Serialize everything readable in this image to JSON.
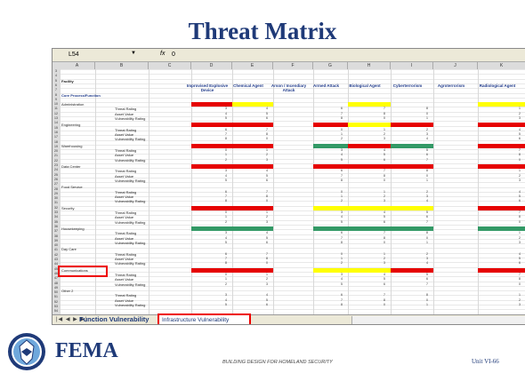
{
  "title": "Threat Matrix",
  "formula_bar": {
    "cell_ref": "L54",
    "fx": "fx",
    "value": "0"
  },
  "column_letters": [
    "A",
    "B",
    "C",
    "D",
    "E",
    "F",
    "G",
    "H",
    "I",
    "J",
    "K"
  ],
  "facility_label": "Facility",
  "function_label": "Core Process/Function",
  "threat_headers": [
    "Improvised Explosive Device",
    "Chemical Agent",
    "Arson / Incendiary Attack",
    "Armed Attack",
    "Biological Agent",
    "Cyberterrorism",
    "Agroterrorism",
    "Radiological Agent"
  ],
  "functions": [
    "Administration",
    "Engineering",
    "Warehousing",
    "Data Center",
    "Food Service",
    "Security",
    "Housekeeping",
    "Day Care",
    "Communications",
    "Other 2"
  ],
  "sub_rows": [
    "Threat Rating",
    "Asset Value",
    "Vulnerability Rating"
  ],
  "tabs": {
    "nav": "|◀ ◀ ▶ ▶|",
    "tab1": "Function Vulnerability",
    "tab2": "Infrastructure Vulnerability"
  },
  "footer": {
    "agency": "FEMA",
    "course": "BUILDING DESIGN FOR HOMELAND SECURITY",
    "unit": "Unit VI-66"
  },
  "colors": {
    "red": "#e60000",
    "yellow": "#ffff00",
    "green": "#339966",
    "title": "#1f3a78"
  }
}
